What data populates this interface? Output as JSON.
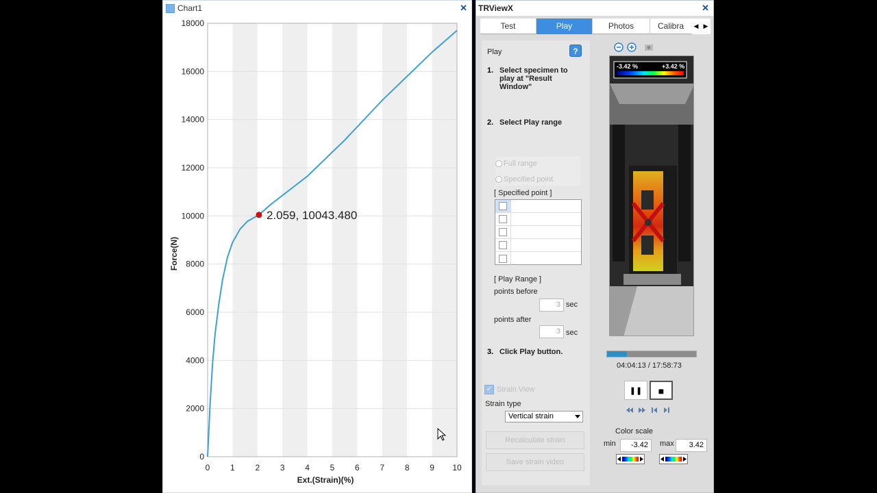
{
  "chart_window": {
    "title": "Chart1",
    "close": "✕"
  },
  "chart_data": {
    "type": "line",
    "title": "",
    "xlabel": "Ext.(Strain)(%)",
    "ylabel": "Force(N)",
    "xlim": [
      0,
      10
    ],
    "ylim": [
      0,
      18000
    ],
    "x_ticks": [
      "0",
      "1",
      "2",
      "3",
      "4",
      "5",
      "6",
      "7",
      "8",
      "9",
      "10"
    ],
    "y_ticks": [
      "0",
      "2000",
      "4000",
      "6000",
      "8000",
      "10000",
      "12000",
      "14000",
      "16000",
      "18000"
    ],
    "grid": "alternating vertical bands",
    "series": [
      {
        "color": "#3aa0d8",
        "x": [
          0,
          0.1,
          0.2,
          0.3,
          0.45,
          0.6,
          0.8,
          1.0,
          1.3,
          1.6,
          2.059,
          2.5,
          3.0,
          3.5,
          4.0,
          4.5,
          5.0,
          5.5,
          6.0,
          6.5,
          7.0,
          7.5,
          8.0,
          8.5,
          9.0,
          9.5,
          10.0
        ],
        "y": [
          0,
          2200,
          3900,
          5100,
          6350,
          7350,
          8300,
          8900,
          9450,
          9780,
          10043,
          10450,
          10850,
          11250,
          11650,
          12150,
          12650,
          13150,
          13700,
          14250,
          14800,
          15300,
          15800,
          16300,
          16800,
          17250,
          17700
        ]
      }
    ],
    "marker": {
      "x": 2.059,
      "y": 10043.48,
      "label": "2.059, 10043.480",
      "color": "#cc1111"
    }
  },
  "trview": {
    "title": "TRViewX",
    "close": "✕",
    "tabs": [
      {
        "label": "Test",
        "active": false
      },
      {
        "label": "Play",
        "active": true
      },
      {
        "label": "Photos",
        "active": false
      },
      {
        "label": "Calibra",
        "active": false
      }
    ],
    "tab_arrow_left": "◀",
    "tab_arrow_right": "▶",
    "play_heading": "Play",
    "help": "?",
    "step1_num": "1.",
    "step1_text": "Select specimen to play at \"Result Window\"",
    "step2_num": "2.",
    "step2_text": "Select Play range",
    "radio_full": "Full range",
    "radio_specified": "Specified point",
    "specified_point_label": "[ Specified point ]",
    "play_range_label": "[ Play Range ]",
    "points_before": "points before",
    "points_before_value": "3",
    "points_after": "points after",
    "points_after_value": "3",
    "sec": "sec",
    "step3_num": "3.",
    "step3_text": "Click Play button.",
    "strain_view": "Strain View",
    "strain_type_label": "Strain type",
    "strain_type_value": "Vertical strain",
    "recalc_button": "Recalculate strain",
    "save_video_button": "Save strain video",
    "scale_min_text": "-3.42 %",
    "scale_max_text": "+3.42 %",
    "time_display": "04:04:13 / 17:58:73",
    "playback_progress": 0.22,
    "pause": "❚❚",
    "stop": "■",
    "color_scale_label": "Color scale",
    "min_label": "min",
    "min_value": "-3.42",
    "max_label": "max",
    "max_value": "3.42",
    "icons": [
      "zoom-out-icon",
      "zoom-in-icon",
      "camera-icon",
      "rewind-icon",
      "forward-icon",
      "step-back-icon",
      "step-forward-icon"
    ]
  }
}
